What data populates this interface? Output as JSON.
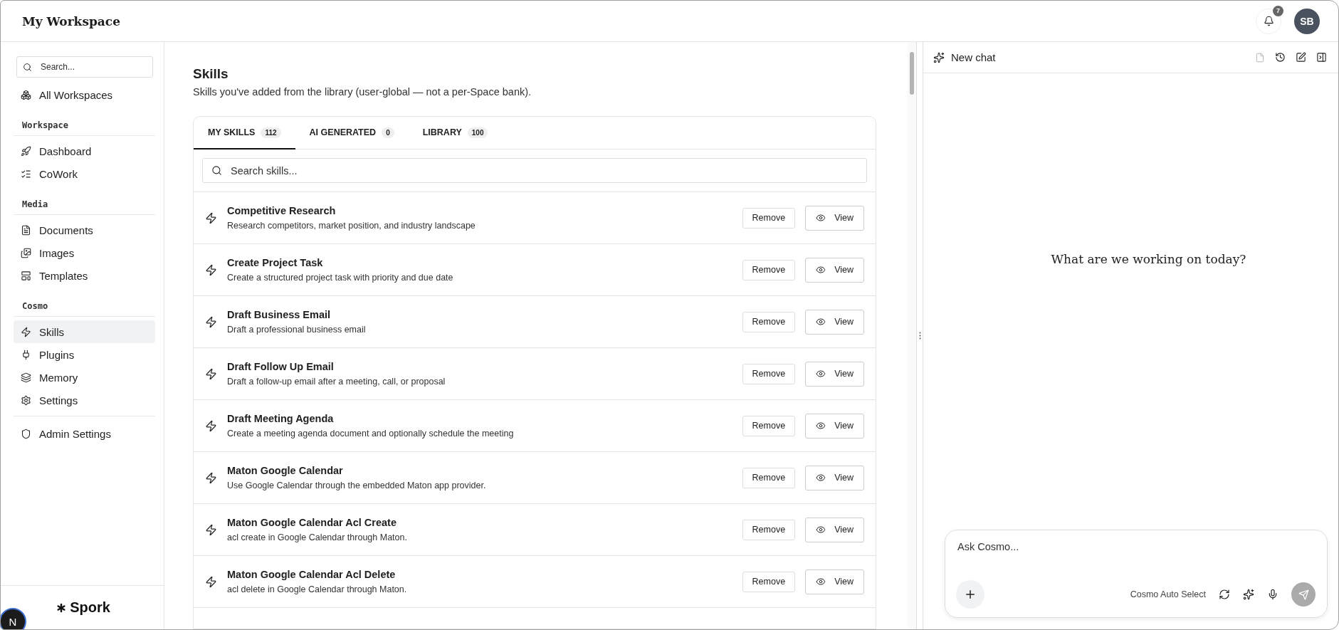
{
  "header": {
    "title": "My Workspace",
    "notification_count": "7",
    "avatar": "SB"
  },
  "sidebar": {
    "search_placeholder": "Search...",
    "groups": [
      {
        "items": [
          {
            "label": "All Workspaces",
            "selected": false
          }
        ]
      },
      {
        "heading": "Workspace",
        "items": [
          {
            "label": "Dashboard",
            "selected": false
          },
          {
            "label": "CoWork",
            "selected": false
          }
        ]
      },
      {
        "heading": "Media",
        "items": [
          {
            "label": "Documents",
            "selected": false
          },
          {
            "label": "Images",
            "selected": false
          },
          {
            "label": "Templates",
            "selected": false
          }
        ]
      },
      {
        "heading": "Cosmo",
        "items": [
          {
            "label": "Skills",
            "selected": true
          },
          {
            "label": "Plugins",
            "selected": false
          },
          {
            "label": "Memory",
            "selected": false
          },
          {
            "label": "Settings",
            "selected": false
          }
        ]
      },
      {
        "items": [
          {
            "label": "Admin Settings",
            "selected": false
          }
        ]
      }
    ],
    "logo": "Spork",
    "dev_badge": "N"
  },
  "main": {
    "title": "Skills",
    "subtitle": "Skills you've added from the library (user-global — not a per-Space bank).",
    "tabs": [
      {
        "label": "MY SKILLS",
        "count": "112",
        "selected": true
      },
      {
        "label": "AI GENERATED",
        "count": "0",
        "selected": false
      },
      {
        "label": "LIBRARY",
        "count": "100",
        "selected": false
      }
    ],
    "search_placeholder": "Search skills...",
    "skills": [
      {
        "name": "Competitive Research",
        "description": "Research competitors, market position, and industry landscape",
        "remove": "Remove",
        "view": "View"
      },
      {
        "name": "Create Project Task",
        "description": "Create a structured project task with priority and due date",
        "remove": "Remove",
        "view": "View"
      },
      {
        "name": "Draft Business Email",
        "description": "Draft a professional business email",
        "remove": "Remove",
        "view": "View"
      },
      {
        "name": "Draft Follow Up Email",
        "description": "Draft a follow-up email after a meeting, call, or proposal",
        "remove": "Remove",
        "view": "View"
      },
      {
        "name": "Draft Meeting Agenda",
        "description": "Create a meeting agenda document and optionally schedule the meeting",
        "remove": "Remove",
        "view": "View"
      },
      {
        "name": "Maton Google Calendar",
        "description": "Use Google Calendar through the embedded Maton app provider.",
        "remove": "Remove",
        "view": "View"
      },
      {
        "name": "Maton Google Calendar Acl Create",
        "description": "acl create in Google Calendar through Maton.",
        "remove": "Remove",
        "view": "View"
      },
      {
        "name": "Maton Google Calendar Acl Delete",
        "description": "acl delete in Google Calendar through Maton.",
        "remove": "Remove",
        "view": "View"
      }
    ]
  },
  "chat": {
    "title": "New chat",
    "prompt": "What are we working on today?",
    "input_placeholder": "Ask Cosmo...",
    "model": "Cosmo Auto Select"
  }
}
